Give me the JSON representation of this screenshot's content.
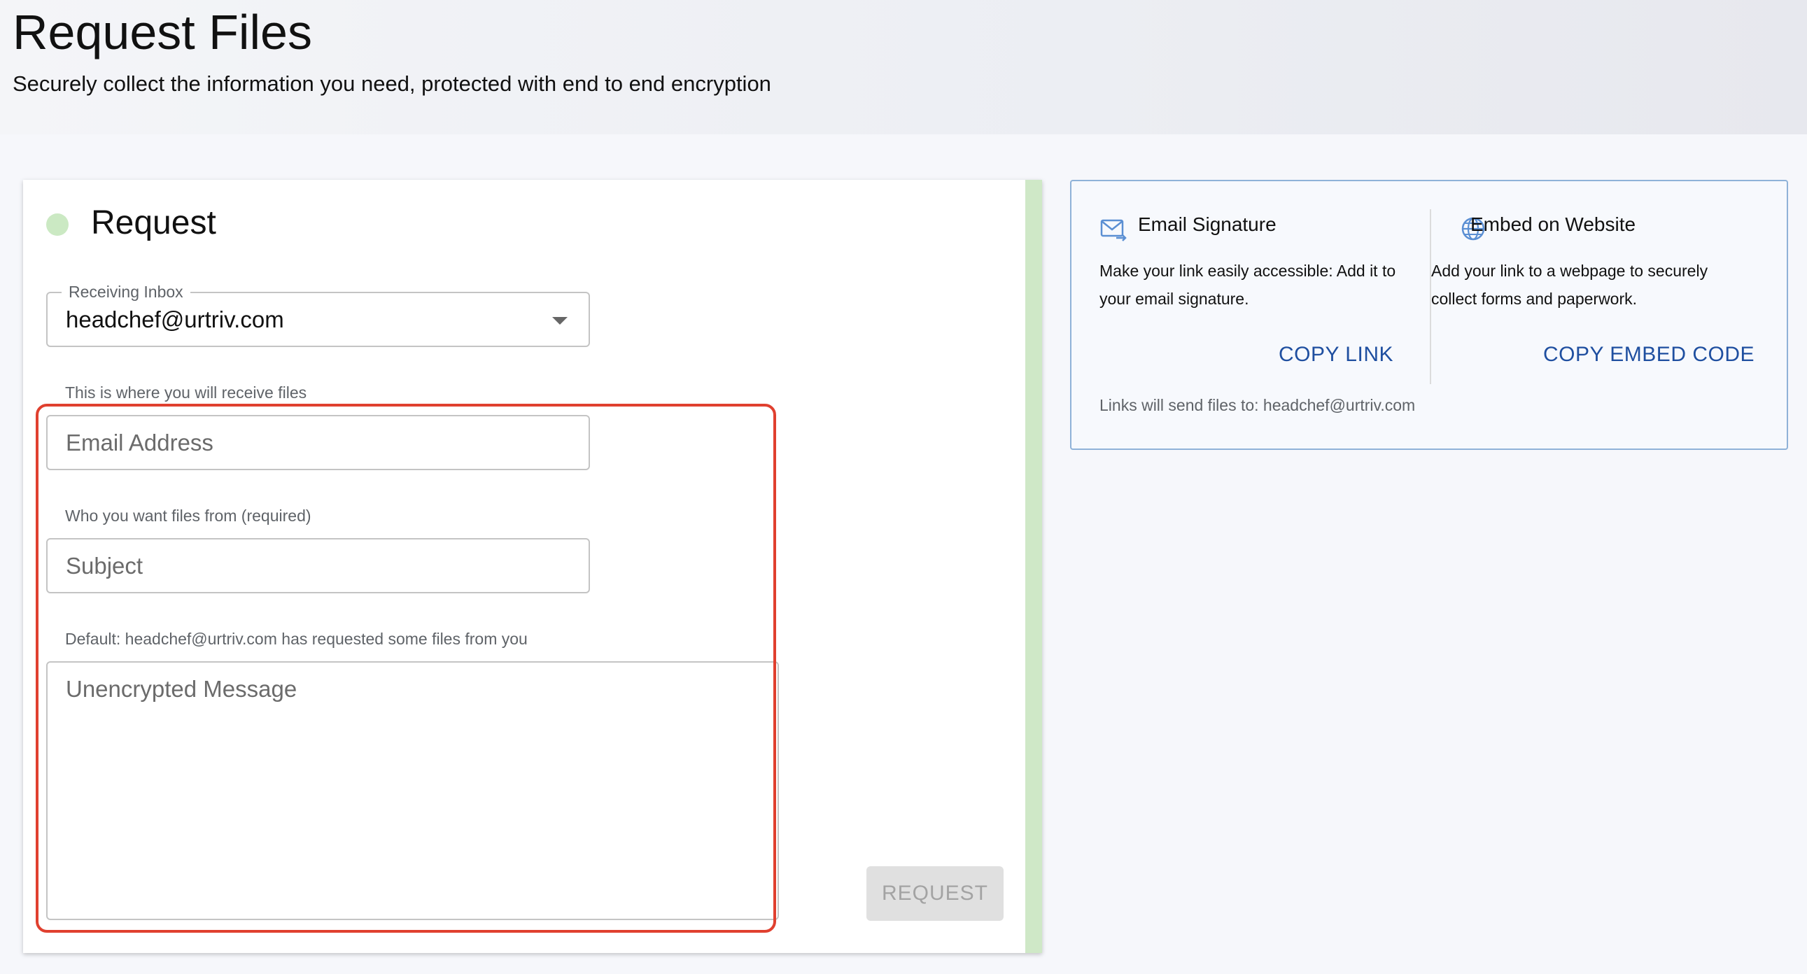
{
  "header": {
    "title": "Request Files",
    "subtitle": "Securely collect the information you need, protected with end to end encryption"
  },
  "request_card": {
    "title": "Request",
    "receiving_inbox": {
      "label": "Receiving Inbox",
      "value": "headchef@urtriv.com",
      "helper": "This is where you will receive files"
    },
    "email_address": {
      "placeholder": "Email Address",
      "helper": "Who you want files from (required)"
    },
    "subject": {
      "placeholder": "Subject",
      "helper": "Default: headchef@urtriv.com has requested some files from you"
    },
    "message": {
      "placeholder": "Unencrypted Message"
    },
    "request_button": "REQUEST"
  },
  "share_card": {
    "email_signature": {
      "heading": "Email Signature",
      "description": "Make your link easily accessible: Add it to your email signature.",
      "action": "COPY LINK",
      "icon": "mail-forward-icon"
    },
    "embed_website": {
      "heading": "Embed on Website",
      "description": "Add your link to a webpage to securely collect forms and paperwork.",
      "action": "COPY EMBED CODE",
      "icon": "globe-icon"
    },
    "footer": "Links will send files to: headchef@urtriv.com"
  },
  "colors": {
    "accent_green": "#cfe8c7",
    "highlight_red": "#e0402f",
    "link_blue": "#1f4fa0",
    "share_border": "#8fb2d8"
  }
}
